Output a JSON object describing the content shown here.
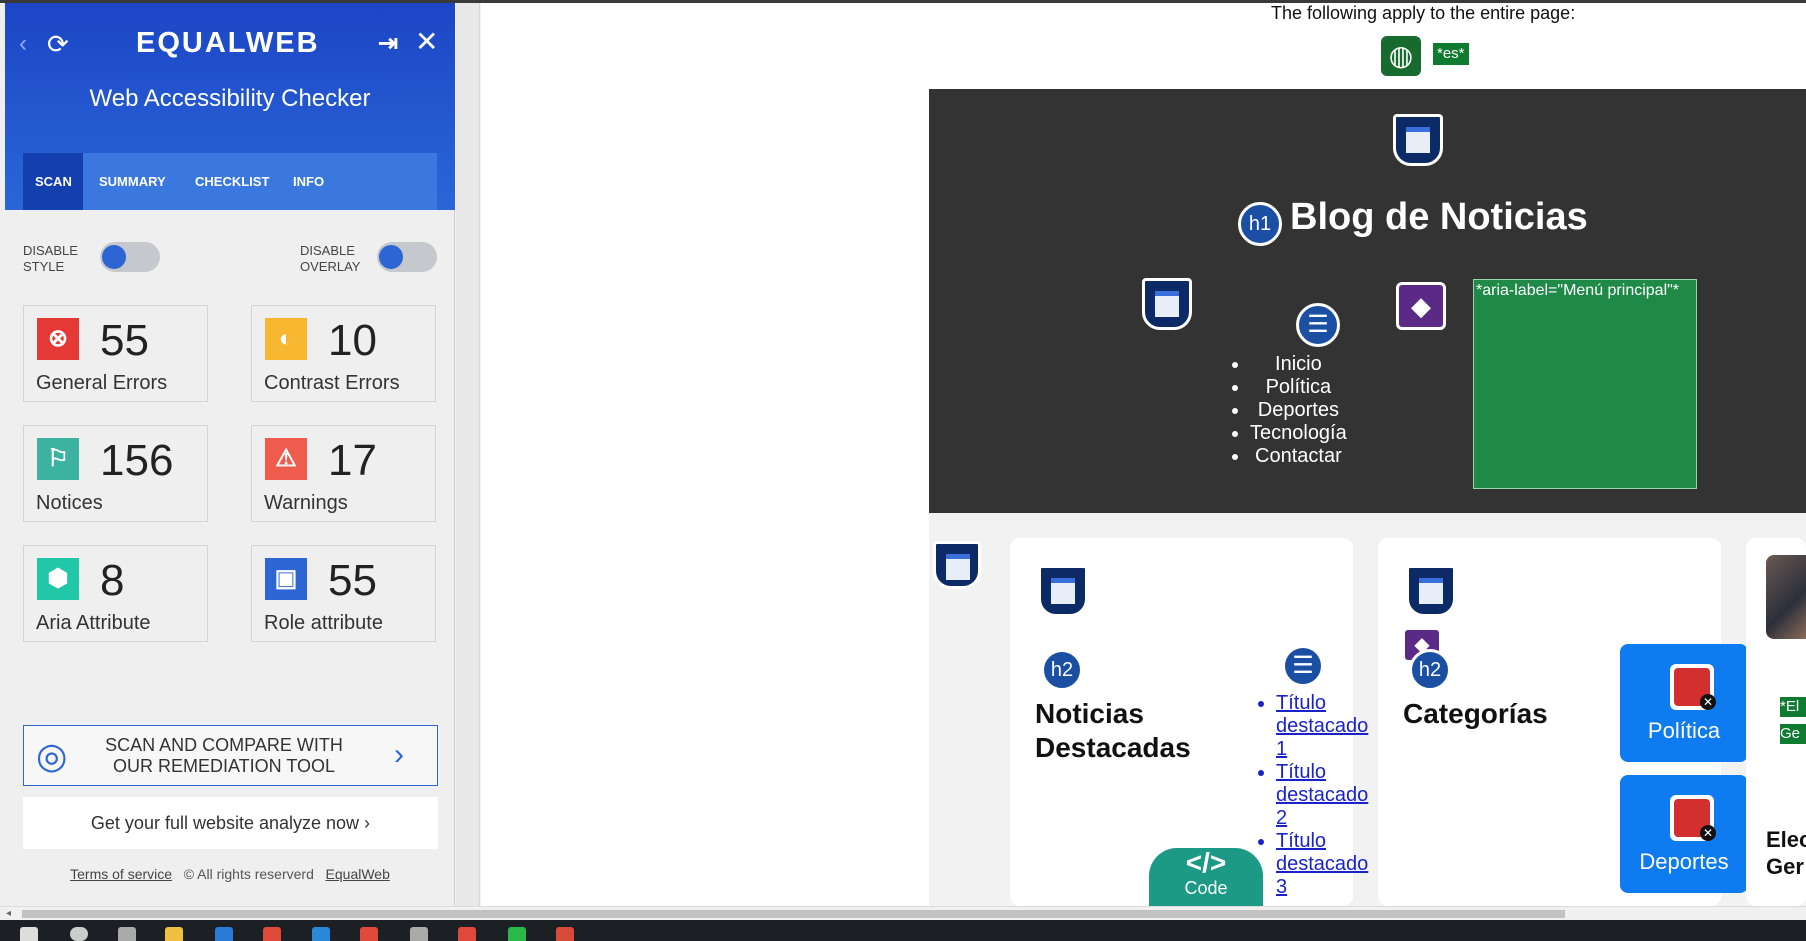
{
  "panel": {
    "logo": "EQUALWEB",
    "title": "Web Accessibility Checker",
    "tabs": [
      {
        "label": "SCAN"
      },
      {
        "label": "SUMMARY"
      },
      {
        "label": "CHECKLIST"
      },
      {
        "label": "INFO"
      }
    ],
    "toggles": {
      "style_label_1": "DISABLE",
      "style_label_2": "STYLE",
      "overlay_label_1": "DISABLE",
      "overlay_label_2": "OVERLAY"
    },
    "cards": [
      {
        "count": "55",
        "label": "General Errors",
        "icon": "error-octagon-icon",
        "color": "#e53935"
      },
      {
        "count": "10",
        "label": "Contrast Errors",
        "icon": "contrast-icon",
        "color": "#f7b731"
      },
      {
        "count": "156",
        "label": "Notices",
        "icon": "flag-icon",
        "color": "#3cb3a0"
      },
      {
        "count": "17",
        "label": "Warnings",
        "icon": "warning-icon",
        "color": "#ef5b4c"
      },
      {
        "count": "8",
        "label": "Aria Attribute",
        "icon": "cube-icon",
        "color": "#21c7a8"
      },
      {
        "count": "55",
        "label": "Role attribute",
        "icon": "badge-icon",
        "color": "#2d66d4"
      }
    ],
    "scan_button": {
      "line1": "SCAN AND COMPARE WITH",
      "line2": "OUR REMEDIATION TOOL"
    },
    "analyze": "Get your full website analyze now ›",
    "footer": {
      "terms": "Terms of service",
      "rights": "© All rights reserverd",
      "brand": "EqualWeb"
    }
  },
  "page": {
    "apply_text": "The following apply to the entire page:",
    "lang_tag": "*es*",
    "h1_badge": "h1",
    "title": "Blog de Noticias",
    "menu": [
      "Inicio",
      "Política",
      "Deportes",
      "Tecnología",
      "Contactar"
    ],
    "aria_label": "*aria-label=\"Menú principal\"*",
    "h2_badge": "h2",
    "section1_title_1": "Noticias",
    "section1_title_2": "Destacadas",
    "links": [
      [
        "Título",
        "destacado",
        "1"
      ],
      [
        "Título",
        "destacado",
        "2"
      ],
      [
        "Título",
        "destacado",
        "3"
      ]
    ],
    "code_badge": "Code",
    "section2_title": "Categorías",
    "categories": [
      "Política",
      "Deportes"
    ],
    "edge_tag_1": "*El",
    "edge_tag_2": "Ge",
    "edge_text_1": "Elec",
    "edge_text_2": "Ger"
  },
  "colors": {
    "panel_blue": "#1c46c6",
    "dark_header": "#333333",
    "green_tag": "#0f7b31",
    "category_blue": "#0f7bf0"
  }
}
